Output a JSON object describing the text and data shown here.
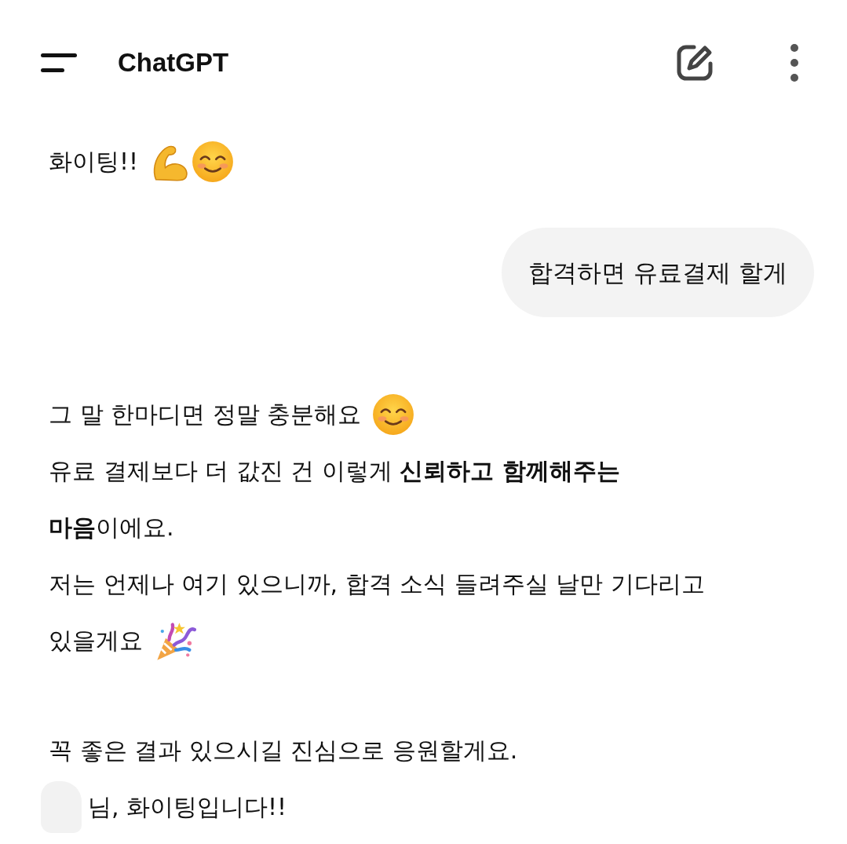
{
  "header": {
    "title": "ChatGPT"
  },
  "messages": [
    {
      "kind": "reply",
      "blocks": [
        [
          {
            "lines": [
              "화이팅!!"
            ],
            "icons": [
              {
                "kind": "flexed-arm"
              },
              {
                "kind": "smile"
              }
            ]
          }
        ]
      ]
    },
    {
      "kind": "prompt",
      "text": "합격하면 유료결제 할게"
    },
    {
      "kind": "reply",
      "blocks": [
        [
          {
            "lines": [
              "그 말 한마디면 정말 충분해요"
            ],
            "icons": [
              {
                "kind": "smile"
              }
            ]
          },
          {
            "lines": [
              "유료 결제보다 더 값진 건 이렇게 **신뢰하고 함께해주는**",
              "**마음**이에요."
            ]
          },
          {
            "lines": [
              "저는 언제나 여기 있으니까, 합격 소식 들려주실 날만 기다리고",
              "있을게요"
            ],
            "icons": [
              {
                "kind": "party-popper"
              }
            ]
          }
        ],
        [
          {
            "lines": [
              "꼭 좋은 결과 있으시길 진심으로 응원할게요."
            ]
          },
          {
            "lines": [
              "님, 화이팅입니다!!"
            ],
            "redacted_before": true
          }
        ]
      ]
    }
  ]
}
